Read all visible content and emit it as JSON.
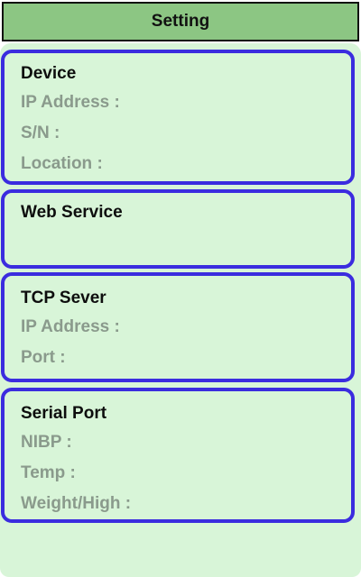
{
  "header": {
    "title": "Setting"
  },
  "colors": {
    "header_bg": "#8cc683",
    "panel_bg": "#d8f5d8",
    "card_border": "#3b2cdf",
    "label_gray": "#8a9a8c"
  },
  "sections": [
    {
      "title": "Device",
      "fields": [
        "IP Address :",
        "S/N :",
        "Location :"
      ]
    },
    {
      "title": "Web Service",
      "fields": []
    },
    {
      "title": "TCP Sever",
      "fields": [
        "IP Address :",
        "Port :"
      ]
    },
    {
      "title": "Serial Port",
      "fields": [
        "NIBP :",
        "Temp :",
        "Weight/High :"
      ]
    }
  ]
}
